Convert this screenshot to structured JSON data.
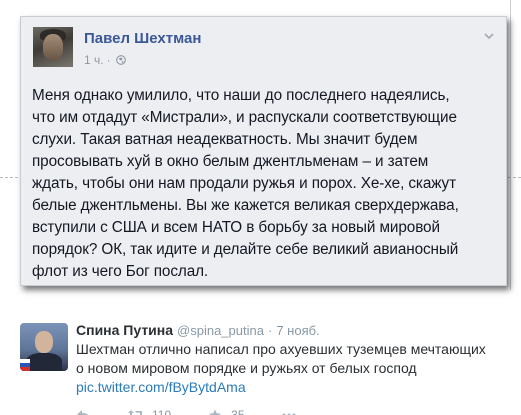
{
  "facebook_post": {
    "author": "Павел Шехтман",
    "time": "1 ч.",
    "separator": "·",
    "icon_globe": "globe-icon",
    "icon_menu": "chevron-down-icon",
    "text_lines": [
      "Меня однако умилило, что наши до последнего надеялись,",
      "что им отдадут «Мистрали», и распускали соответствующие",
      "слухи. Такая ватная неадекватность. Мы значит будем",
      "просовывать хуй в окно белым джентльменам – и затем",
      "ждать, чтобы они нам продали ружья и порох. Хе-хе, скажут",
      "белые джентльмены. Вы же кажется великая сверхдержава,",
      "вступили с США и всем НАТО в борьбу за новый мировой",
      "порядок? ОК, так идите и делайте себе великий авианосный",
      "флот из чего Бог послал."
    ]
  },
  "tweet": {
    "name": "Спина Путина",
    "handle": "@spina_putina",
    "separator": "·",
    "time": "7 нояб.",
    "text_lines": [
      "Шехтман отлично написал про ахуевших туземцев мечтающих",
      "о новом мировом порядке и ружьях от белых господ"
    ],
    "link": "pic.twitter.com/fByBytdAma",
    "actions": {
      "reply_icon": "reply-icon",
      "retweet_icon": "retweet-icon",
      "retweet_count": "110",
      "favorite_icon": "star-icon",
      "favorite_count": "35"
    }
  },
  "colors": {
    "fb_link": "#3b5998",
    "fb_card_bg": "#edeef2",
    "tw_link": "#2b7bb9",
    "tw_meta": "#8899a6"
  }
}
